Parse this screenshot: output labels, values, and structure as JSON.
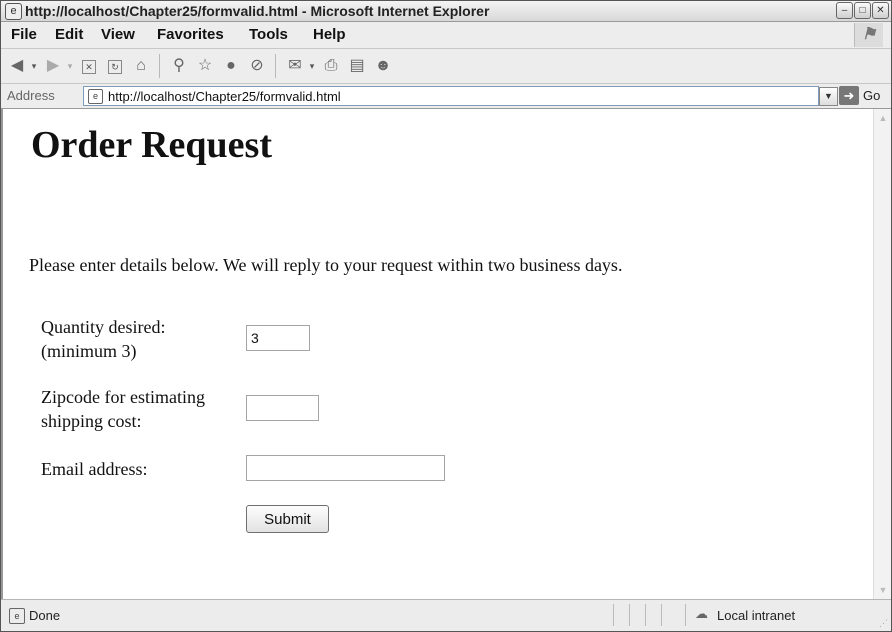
{
  "window": {
    "title": "http://localhost/Chapter25/formvalid.html - Microsoft Internet Explorer",
    "controls": {
      "minimize": "–",
      "maximize": "□",
      "close": "✕"
    }
  },
  "menu": {
    "items": [
      "File",
      "Edit",
      "View",
      "Favorites",
      "Tools",
      "Help"
    ]
  },
  "toolbar": {
    "buttons": [
      "back-icon",
      "forward-icon",
      "stop-icon",
      "refresh-icon",
      "home-icon",
      "search-icon",
      "favorites-icon",
      "media-icon",
      "history-icon",
      "mail-icon",
      "print-icon",
      "edit-icon",
      "messenger-icon"
    ]
  },
  "address": {
    "label": "Address",
    "url": "http://localhost/Chapter25/formvalid.html",
    "go_label": "Go"
  },
  "page": {
    "heading": "Order Request",
    "intro": "Please enter details below. We will reply to your request within two business days.",
    "form": {
      "quantity_label_line1": "Quantity desired:",
      "quantity_label_line2": "(minimum 3)",
      "quantity_value": "3",
      "zip_label_line1": "Zipcode for estimating",
      "zip_label_line2": "shipping cost:",
      "zip_value": "",
      "email_label": "Email address:",
      "email_value": "",
      "submit_label": "Submit"
    }
  },
  "status": {
    "text": "Done",
    "zone": "Local intranet"
  }
}
